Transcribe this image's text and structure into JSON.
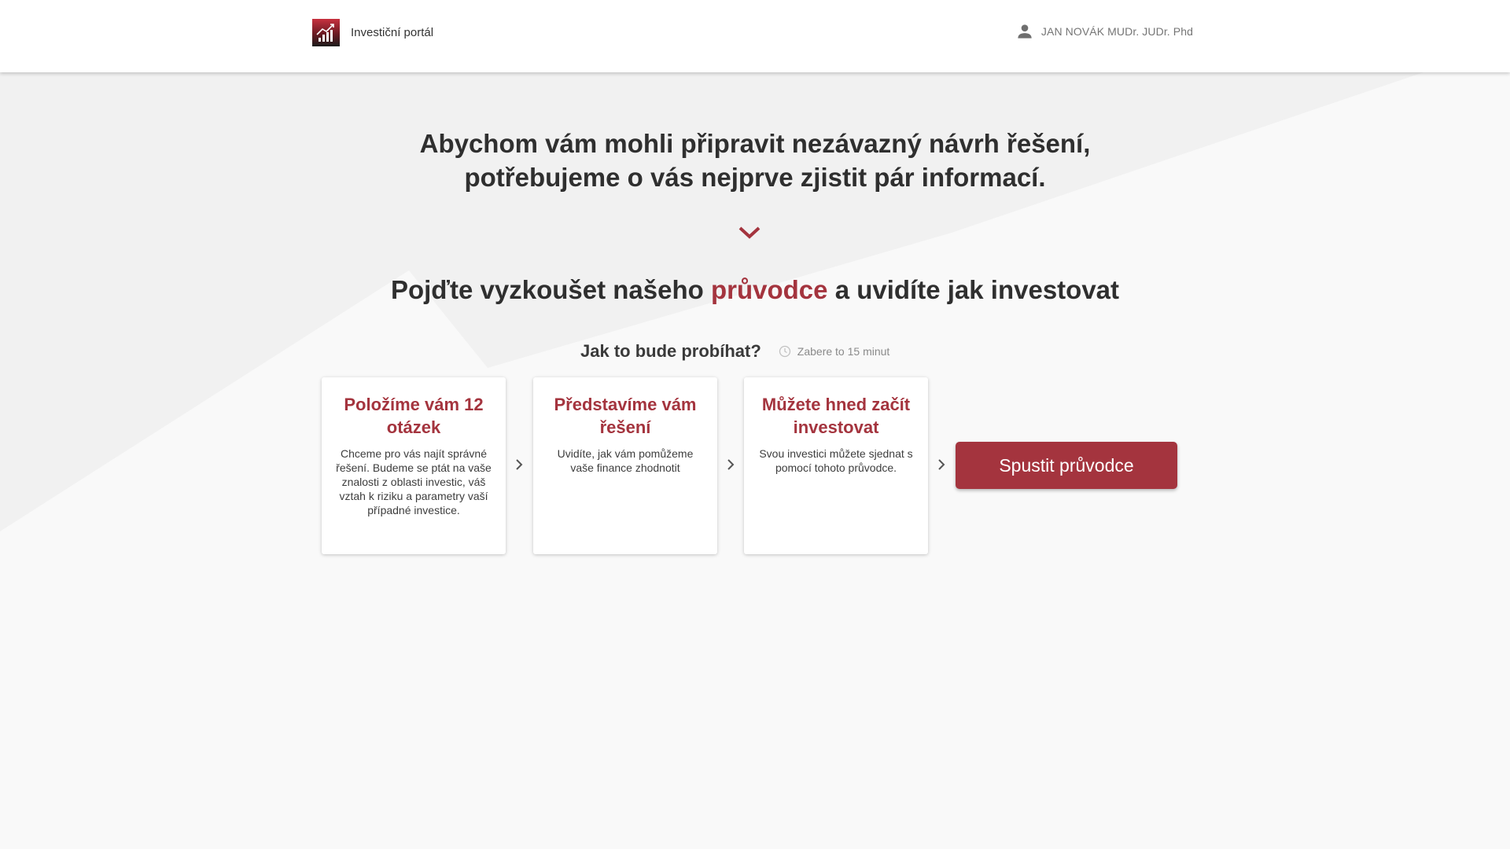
{
  "header": {
    "brand_name": "Investiční portál",
    "user_name": "JAN NOVÁK MUDr. JUDr. Phd"
  },
  "intro": {
    "line1": "Abychom vám mohli připravit nezávazný návrh řešení,",
    "line2": "potřebujeme o vás nejprve zjistit pár informací."
  },
  "headline": {
    "before": "Pojďte vyzkoušet našeho ",
    "accent": "průvodce",
    "after": " a uvidíte jak investovat"
  },
  "how": {
    "title": "Jak to bude probíhat?",
    "duration": "Zabere to 15 minut"
  },
  "steps": [
    {
      "title": "Položíme vám 12 otázek",
      "text": "Chceme pro vás najít správné řešení. Budeme se ptát na vaše znalosti z oblasti investic, váš vztah k riziku a parametry vaší případné investice."
    },
    {
      "title": "Představíme vám řešení",
      "text": "Uvidíte, jak vám pomůžeme vaše finance zhodnotit"
    },
    {
      "title": "Můžete hned začít investovat",
      "text": "Svou investici můžete sjednat s pomocí tohoto průvodce."
    }
  ],
  "cta": {
    "label": "Spustit průvodce"
  },
  "icons": {
    "logo": "chart-logo-icon",
    "user": "person-icon",
    "scroll": "chevron-down-icon",
    "time": "clock-icon",
    "step_arrow": "chevron-right-icon"
  },
  "colors": {
    "accent": "#a4343e",
    "background": "#f7f7f7",
    "header": "#ffffff"
  }
}
